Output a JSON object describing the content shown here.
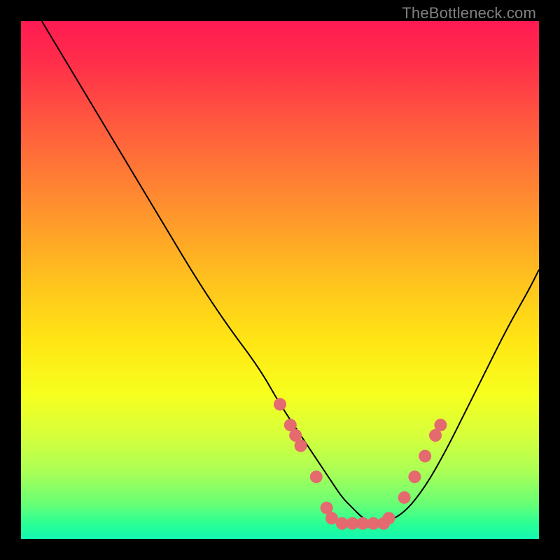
{
  "watermark": "TheBottleneck.com",
  "chart_data": {
    "type": "line",
    "title": "",
    "xlabel": "",
    "ylabel": "",
    "xlim": [
      0,
      100
    ],
    "ylim": [
      0,
      100
    ],
    "series": [
      {
        "name": "bottleneck-curve",
        "x": [
          4,
          10,
          16,
          22,
          28,
          34,
          40,
          46,
          50,
          54,
          58,
          60,
          62,
          64,
          66,
          68,
          70,
          74,
          78,
          82,
          86,
          90,
          94,
          98,
          100
        ],
        "y": [
          100,
          90,
          80,
          70,
          60,
          50,
          41,
          33,
          26,
          20,
          14,
          11,
          8,
          6,
          4,
          3,
          3,
          5,
          10,
          17,
          25,
          33,
          41,
          48,
          52
        ]
      }
    ],
    "markers": {
      "name": "sample-points",
      "color": "#e46a6f",
      "points": [
        {
          "x": 50,
          "y": 26
        },
        {
          "x": 52,
          "y": 22
        },
        {
          "x": 53,
          "y": 20
        },
        {
          "x": 54,
          "y": 18
        },
        {
          "x": 57,
          "y": 12
        },
        {
          "x": 59,
          "y": 6
        },
        {
          "x": 60,
          "y": 4
        },
        {
          "x": 62,
          "y": 3
        },
        {
          "x": 64,
          "y": 3
        },
        {
          "x": 66,
          "y": 3
        },
        {
          "x": 68,
          "y": 3
        },
        {
          "x": 70,
          "y": 3
        },
        {
          "x": 71,
          "y": 4
        },
        {
          "x": 74,
          "y": 8
        },
        {
          "x": 76,
          "y": 12
        },
        {
          "x": 78,
          "y": 16
        },
        {
          "x": 80,
          "y": 20
        },
        {
          "x": 81,
          "y": 22
        }
      ]
    }
  }
}
